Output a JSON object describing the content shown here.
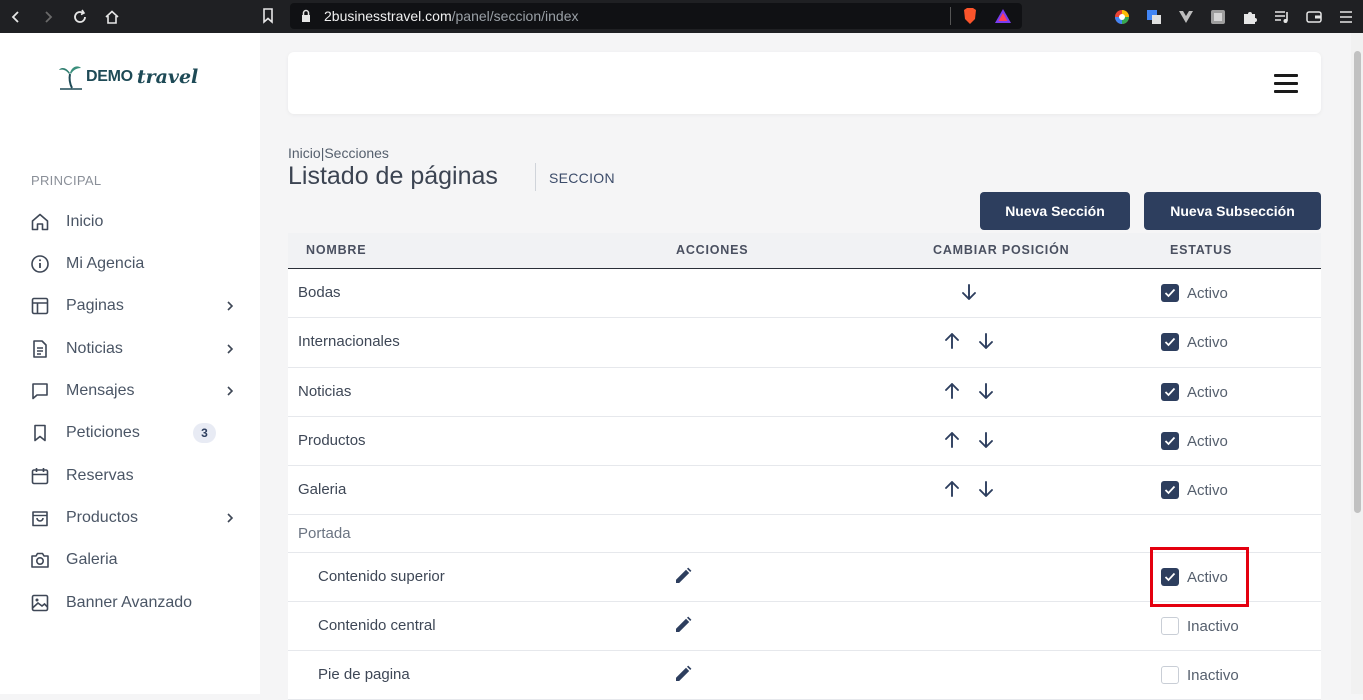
{
  "browser": {
    "url_host": "2businesstravel.com",
    "url_path": "/panel/seccion/index"
  },
  "sidebar": {
    "logo_a": "DEMO",
    "logo_b": "travel",
    "section": "PRINCIPAL",
    "items": [
      {
        "label": "Inicio",
        "icon": "home-icon"
      },
      {
        "label": "Mi Agencia",
        "icon": "info-icon"
      },
      {
        "label": "Paginas",
        "icon": "layout-icon"
      },
      {
        "label": "Noticias",
        "icon": "document-icon"
      },
      {
        "label": "Mensajes",
        "icon": "message-icon"
      },
      {
        "label": "Peticiones",
        "icon": "bookmark-icon",
        "badge": "3"
      },
      {
        "label": "Reservas",
        "icon": "calendar-icon"
      },
      {
        "label": "Productos",
        "icon": "shopping-bag-icon"
      },
      {
        "label": "Galeria",
        "icon": "camera-icon"
      },
      {
        "label": "Banner Avanzado",
        "icon": "image-icon"
      }
    ]
  },
  "header": {
    "breadcrumb_home": "Inicio",
    "breadcrumb_sep": "|",
    "breadcrumb_current": "Secciones",
    "title": "Listado de páginas",
    "subtitle": "SECCION",
    "btn_new_section": "Nueva Sección",
    "btn_new_subsection": "Nueva Subsección"
  },
  "table": {
    "headers": {
      "name": "NOMBRE",
      "actions": "ACCIONES",
      "position": "CAMBIAR POSICIÓN",
      "status": "ESTATUS"
    },
    "rows": [
      {
        "name": "Bodas",
        "status": "Activo"
      },
      {
        "name": "Internacionales",
        "status": "Activo"
      },
      {
        "name": "Noticias",
        "status": "Activo"
      },
      {
        "name": "Productos",
        "status": "Activo"
      },
      {
        "name": "Galeria",
        "status": "Activo"
      },
      {
        "name": "Portada"
      },
      {
        "name": "Contenido superior",
        "status": "Activo"
      },
      {
        "name": "Contenido central",
        "status": "Inactivo"
      },
      {
        "name": "Pie de pagina",
        "status": "Inactivo"
      }
    ]
  },
  "colors": {
    "primary": "#2d3e5e",
    "highlight": "#e4000f"
  }
}
